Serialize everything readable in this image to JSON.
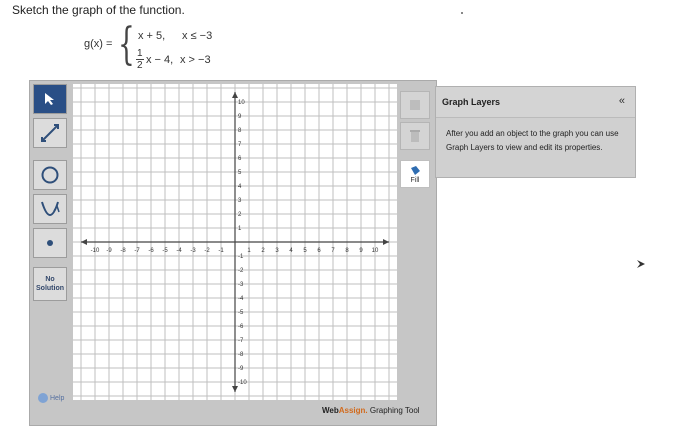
{
  "prompt": "Sketch the graph of the function.",
  "formula": {
    "lhs": "g(x) =",
    "case1_expr": "x + 5,",
    "case1_cond": "x ≤ −3",
    "case2_num": "1",
    "case2_den": "2",
    "case2_expr": "x − 4,",
    "case2_cond": "x > −3"
  },
  "tools": {
    "no_solution": "No Solution",
    "help": "Help"
  },
  "right_tools": {
    "fill": "Fill"
  },
  "graph": {
    "x_ticks": [
      "-10",
      "-9",
      "-8",
      "-7",
      "-6",
      "-5",
      "-4",
      "-3",
      "-2",
      "-1",
      "1",
      "2",
      "3",
      "4",
      "5",
      "6",
      "7",
      "8",
      "9",
      "10"
    ],
    "y_ticks_pos": [
      "10",
      "9",
      "8",
      "7",
      "6",
      "5",
      "4",
      "3",
      "2",
      "1"
    ],
    "y_ticks_neg": [
      "-1",
      "-2",
      "-3",
      "-4",
      "-5",
      "-6",
      "-7",
      "-8",
      "-9",
      "-10"
    ]
  },
  "brand": {
    "web": "Web",
    "assign": "Assign.",
    "rest": " Graphing Tool"
  },
  "layers": {
    "title": "Graph Layers",
    "collapse": "«",
    "message": "After you add an object to the graph you can use Graph Layers to view and edit its properties."
  }
}
